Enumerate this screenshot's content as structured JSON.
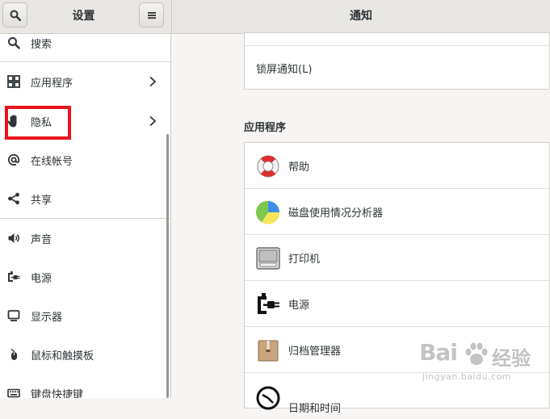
{
  "header": {
    "left_title": "设置",
    "right_title": "通知",
    "search_icon": "search-icon",
    "menu_icon": "hamburger-menu-icon"
  },
  "sidebar": {
    "items": [
      {
        "label": "搜索",
        "icon": "search-icon"
      },
      {
        "label": "应用程序",
        "icon": "grid-icon",
        "has_arrow": true
      },
      {
        "label": "隐私",
        "icon": "hand-icon",
        "has_arrow": true,
        "highlighted": true
      },
      {
        "label": "在线帐号",
        "icon": "at-icon"
      },
      {
        "label": "共享",
        "icon": "share-icon"
      },
      {
        "label": "声音",
        "icon": "speaker-icon"
      },
      {
        "label": "电源",
        "icon": "power-plug-icon"
      },
      {
        "label": "显示器",
        "icon": "monitor-icon"
      },
      {
        "label": "鼠标和触摸板",
        "icon": "mouse-icon"
      },
      {
        "label": "键盘快捷键",
        "icon": "keyboard-icon"
      }
    ]
  },
  "main": {
    "lock_screen_label": "锁屏通知(L)",
    "section_title": "应用程序",
    "apps": [
      {
        "label": "帮助",
        "icon": "lifebuoy-icon"
      },
      {
        "label": "磁盘使用情况分析器",
        "icon": "disk-usage-pie-icon"
      },
      {
        "label": "打印机",
        "icon": "printer-icon"
      },
      {
        "label": "电源",
        "icon": "power-plug-icon"
      },
      {
        "label": "归档管理器",
        "icon": "archive-box-icon"
      },
      {
        "label": "日期和时间",
        "icon": "clock-icon"
      }
    ]
  },
  "watermark": {
    "brand": "Bai",
    "cn": "经验",
    "url": "jingyan.baidu.com"
  },
  "colors": {
    "highlight": "#e8151b",
    "sidebar_bg": "#ffffff",
    "window_bg": "#f6f5f4"
  }
}
